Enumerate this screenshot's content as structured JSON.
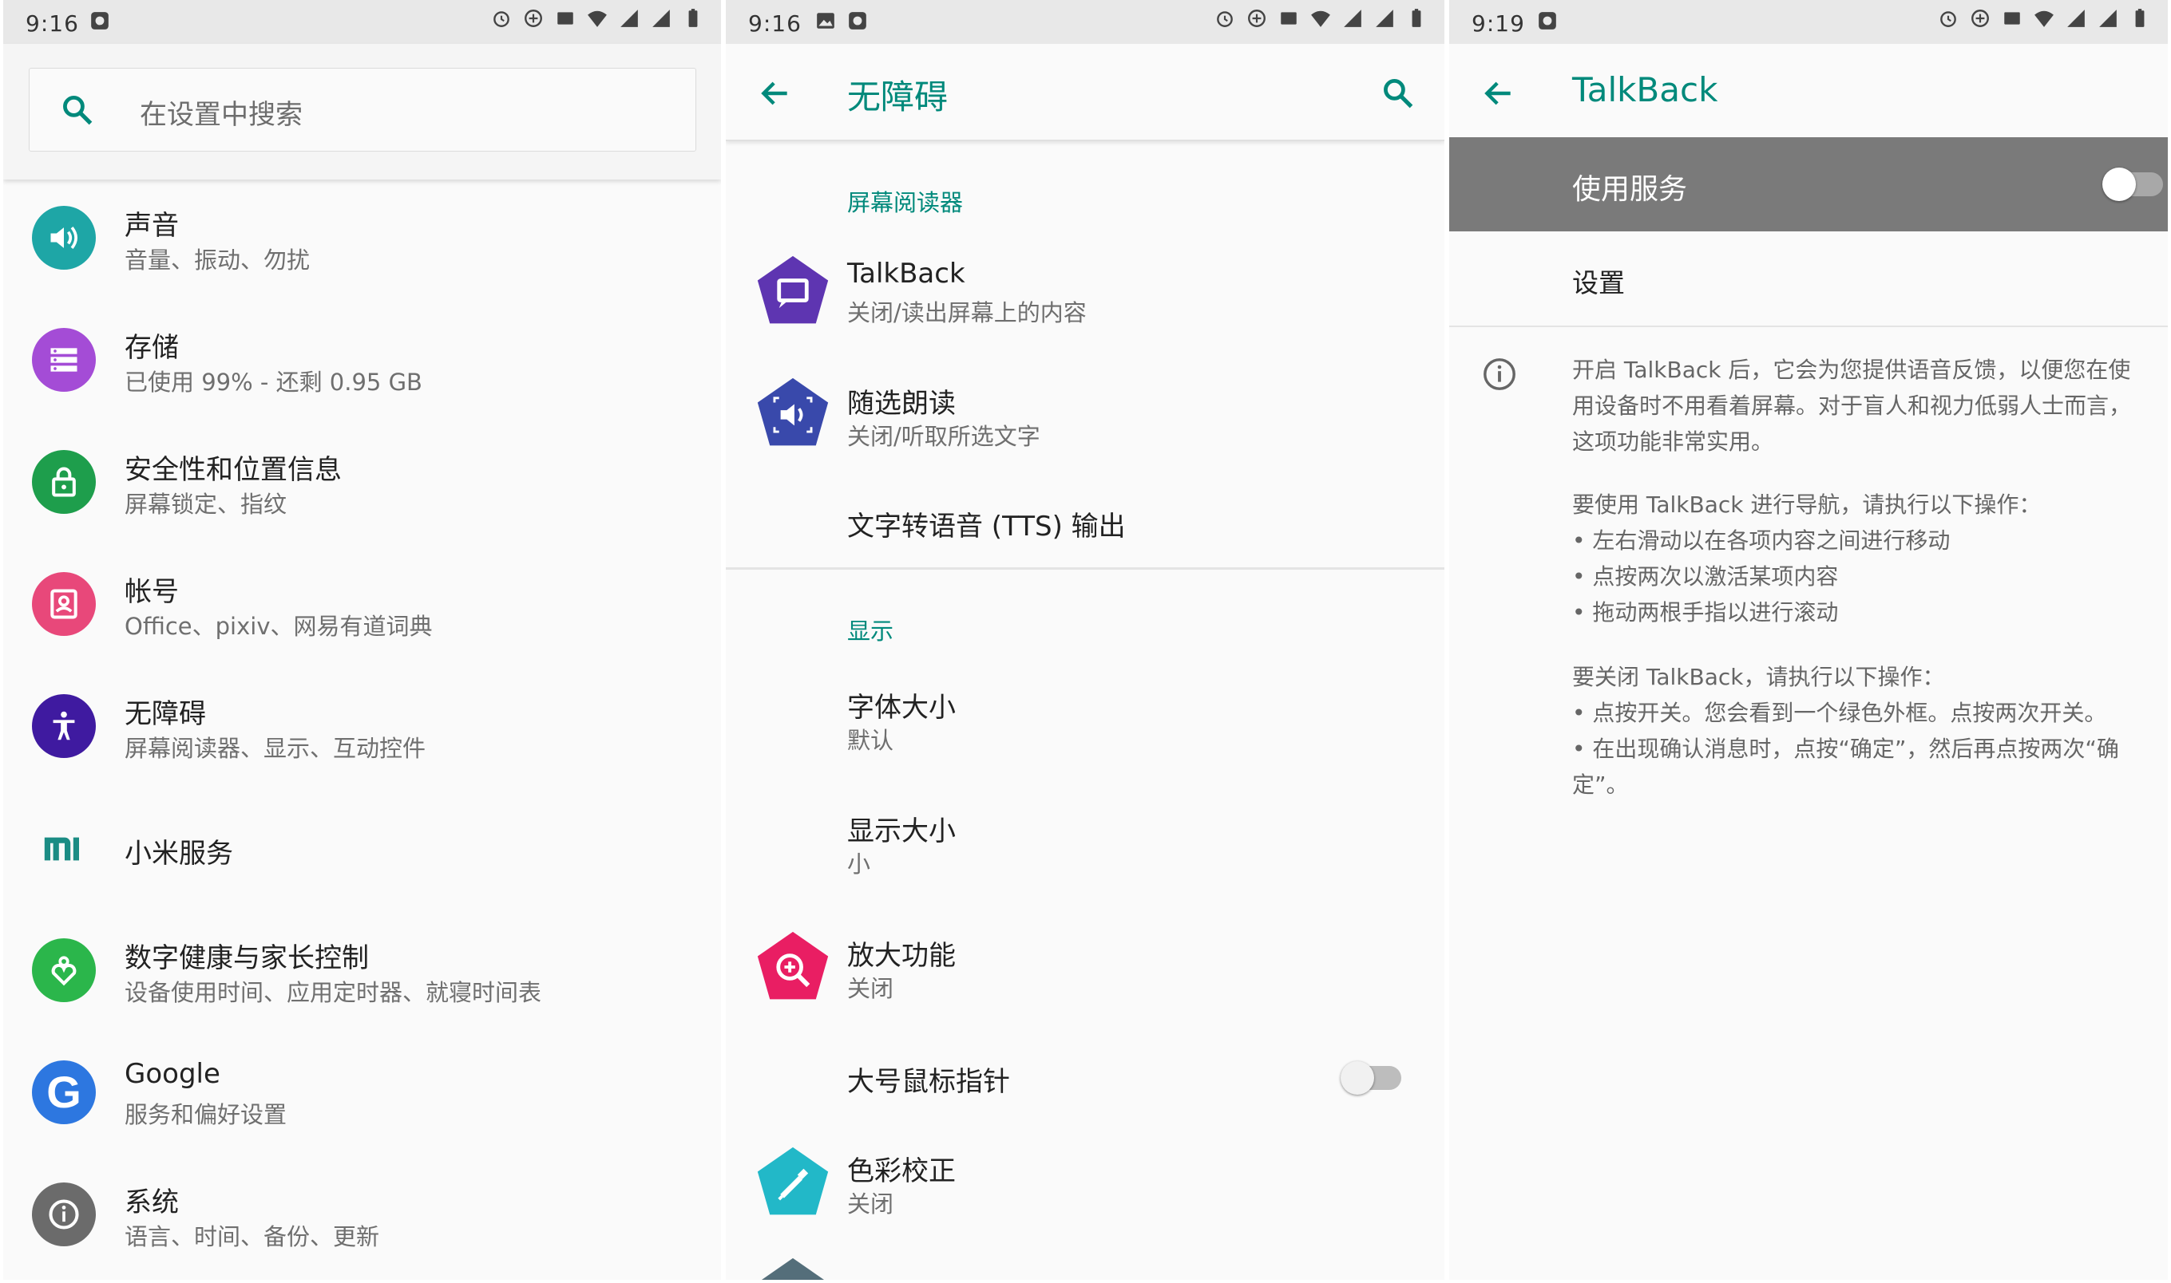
{
  "colors": {
    "accent": "#00897b",
    "sound": "#1ea6a6",
    "storage": "#a44cd6",
    "security": "#1e9e4c",
    "accounts": "#e8487a",
    "accessibility": "#3f1aa0",
    "mi": "#1b8c84",
    "wellbeing": "#2bb64b",
    "google": "#2d77e0",
    "system": "#6b6b6b",
    "talkback": "#5e35b1",
    "select_to_speak": "#3949ab",
    "magnify": "#e91e63",
    "color_correction": "#22b8c8"
  },
  "panel1": {
    "status": {
      "time": "9:16"
    },
    "search": {
      "placeholder": "在设置中搜索",
      "icon": "search-icon"
    },
    "items": [
      {
        "title": "声音",
        "subtitle": "音量、振动、勿扰",
        "icon": "volume-icon"
      },
      {
        "title": "存储",
        "subtitle": "已使用 99% - 还剩 0.95 GB",
        "icon": "storage-icon"
      },
      {
        "title": "安全性和位置信息",
        "subtitle": "屏幕锁定、指纹",
        "icon": "lock-icon"
      },
      {
        "title": "帐号",
        "subtitle": "Office、pixiv、网易有道词典",
        "icon": "account-icon"
      },
      {
        "title": "无障碍",
        "subtitle": "屏幕阅读器、显示、互动控件",
        "icon": "accessibility-icon"
      },
      {
        "title": "小米服务",
        "subtitle": "",
        "icon": "mi-icon"
      },
      {
        "title": "数字健康与家长控制",
        "subtitle": "设备使用时间、应用定时器、就寝时间表",
        "icon": "wellbeing-icon"
      },
      {
        "title": "Google",
        "subtitle": "服务和偏好设置",
        "icon": "google-icon"
      },
      {
        "title": "系统",
        "subtitle": "语言、时间、备份、更新",
        "icon": "info-icon"
      }
    ]
  },
  "panel2": {
    "status": {
      "time": "9:16"
    },
    "title": "无障碍",
    "section_screen_reader": "屏幕阅读器",
    "section_display": "显示",
    "items": {
      "talkback": {
        "title": "TalkBack",
        "subtitle": "关闭/读出屏幕上的内容"
      },
      "select_to_speak": {
        "title": "随选朗读",
        "subtitle": "关闭/听取所选文字"
      },
      "tts": {
        "title": "文字转语音 (TTS) 输出"
      },
      "font_size": {
        "title": "字体大小",
        "subtitle": "默认"
      },
      "display_size": {
        "title": "显示大小",
        "subtitle": "小"
      },
      "magnification": {
        "title": "放大功能",
        "subtitle": "关闭"
      },
      "large_pointer": {
        "title": "大号鼠标指针",
        "enabled": false
      },
      "color_correction": {
        "title": "色彩校正",
        "subtitle": "关闭"
      }
    }
  },
  "panel3": {
    "status": {
      "time": "9:19"
    },
    "title": "TalkBack",
    "use_service": {
      "label": "使用服务",
      "enabled": false
    },
    "settings_label": "设置",
    "description": {
      "intro": "开启 TalkBack 后，它会为您提供语音反馈，以便您在使用设备时不用看着屏幕。对于盲人和视力低弱人士而言，这项功能非常实用。",
      "nav_heading": "要使用 TalkBack 进行导航，请执行以下操作：",
      "nav_items": [
        "• 左右滑动以在各项内容之间进行移动",
        "• 点按两次以激活某项内容",
        "• 拖动两根手指以进行滚动"
      ],
      "off_heading": "要关闭 TalkBack，请执行以下操作：",
      "off_items": [
        "• 点按开关。您会看到一个绿色外框。点按两次开关。",
        "• 在出现确认消息时，点按“确定”，然后再点按两次“确定”。"
      ]
    }
  }
}
